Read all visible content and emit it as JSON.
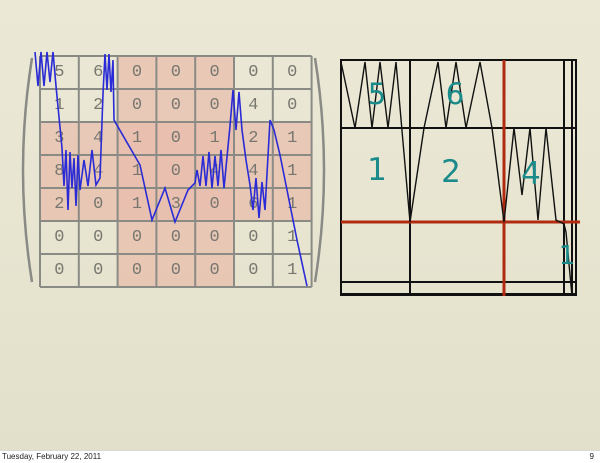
{
  "matrix": {
    "rows": [
      [
        "5",
        "6",
        "0",
        "0",
        "0",
        "0",
        "0"
      ],
      [
        "1",
        "2",
        "0",
        "0",
        "0",
        "4",
        "0"
      ],
      [
        "3",
        "4",
        "1",
        "0",
        "1",
        "2",
        "1"
      ],
      [
        "8",
        "4",
        "1",
        "0",
        "4",
        "4",
        "1"
      ],
      [
        "2",
        "0",
        "1",
        "3",
        "0",
        "6",
        "1"
      ],
      [
        "0",
        "0",
        "0",
        "0",
        "0",
        "0",
        "1"
      ],
      [
        "0",
        "0",
        "0",
        "0",
        "0",
        "0",
        "1"
      ]
    ],
    "highlight_color": "#e8b7a6",
    "grid_color": "#8b8b86",
    "text_color": "#777770"
  },
  "block_diagram": {
    "labels": [
      "5",
      "6",
      "1",
      "2",
      "4",
      "1"
    ],
    "label_color": "#1a8a8a",
    "separator_color": "#b02a10"
  },
  "trace_color": "#2a2bd6",
  "footer": {
    "date": "Tuesday, February 22, 2011",
    "page": "9"
  }
}
